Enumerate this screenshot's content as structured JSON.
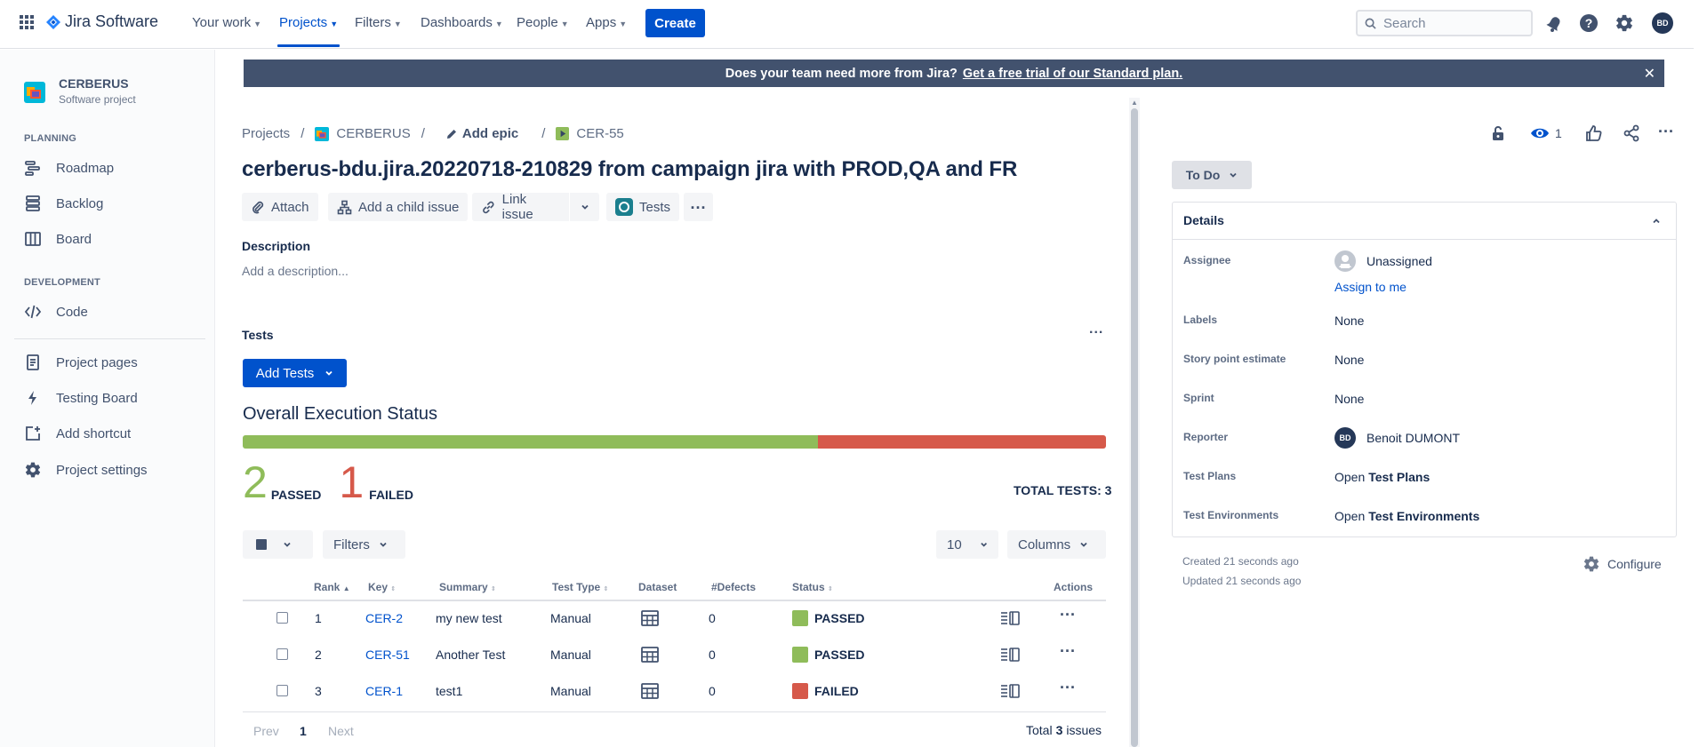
{
  "topnav": {
    "app_name": "Jira Software",
    "items": [
      {
        "label": "Your work"
      },
      {
        "label": "Projects"
      },
      {
        "label": "Filters"
      },
      {
        "label": "Dashboards"
      },
      {
        "label": "People"
      },
      {
        "label": "Apps"
      }
    ],
    "create_label": "Create",
    "search_placeholder": "Search",
    "avatar_initials": "BD"
  },
  "sidebar": {
    "project_name": "CERBERUS",
    "project_type": "Software project",
    "planning_label": "PLANNING",
    "planning_items": [
      {
        "label": "Roadmap",
        "icon": "roadmap-icon"
      },
      {
        "label": "Backlog",
        "icon": "backlog-icon"
      },
      {
        "label": "Board",
        "icon": "board-icon"
      }
    ],
    "development_label": "DEVELOPMENT",
    "development_items": [
      {
        "label": "Code",
        "icon": "code-icon"
      }
    ],
    "other_items": [
      {
        "label": "Project pages",
        "icon": "page-icon"
      },
      {
        "label": "Testing Board",
        "icon": "lightning-icon"
      },
      {
        "label": "Add shortcut",
        "icon": "add-shortcut-icon"
      },
      {
        "label": "Project settings",
        "icon": "gear-icon"
      }
    ]
  },
  "banner": {
    "text": "Does your team need more from Jira?",
    "link": "Get a free trial of our Standard plan."
  },
  "issue": {
    "breadcrumb": {
      "projects": "Projects",
      "project": "CERBERUS",
      "add_epic": "Add epic",
      "key": "CER-55"
    },
    "title": "cerberus-bdu.jira.20220718-210829 from campaign jira with PROD,QA and FR",
    "toolbar": {
      "attach": "Attach",
      "add_child": "Add a child issue",
      "link_issue": "Link issue",
      "tests": "Tests"
    },
    "description_label": "Description",
    "description_placeholder": "Add a description...",
    "tests_label": "Tests",
    "add_tests_label": "Add Tests"
  },
  "execution": {
    "title": "Overall Execution Status",
    "passed_count": "2",
    "passed_label": "PASSED",
    "failed_count": "1",
    "failed_label": "FAILED",
    "passed_fraction": 0.6667,
    "total_label": "TOTAL TESTS: 3",
    "colors": {
      "passed": "#8FBC5A",
      "failed": "#D6594A"
    }
  },
  "table_controls": {
    "filters_label": "Filters",
    "page_size": "10",
    "columns_label": "Columns"
  },
  "table": {
    "headers": {
      "rank": "Rank",
      "key": "Key",
      "summary": "Summary",
      "test_type": "Test Type",
      "dataset": "Dataset",
      "defects": "#Defects",
      "status": "Status",
      "actions": "Actions"
    },
    "rows": [
      {
        "rank": "1",
        "key": "CER-2",
        "summary": "my new test",
        "type": "Manual",
        "defects": "0",
        "status": "PASSED",
        "color": "#8FBC5A"
      },
      {
        "rank": "2",
        "key": "CER-51",
        "summary": "Another Test",
        "type": "Manual",
        "defects": "0",
        "status": "PASSED",
        "color": "#8FBC5A"
      },
      {
        "rank": "3",
        "key": "CER-1",
        "summary": "test1",
        "type": "Manual",
        "defects": "0",
        "status": "FAILED",
        "color": "#D6594A"
      }
    ],
    "pagination": {
      "prev": "Prev",
      "page": "1",
      "next": "Next",
      "total_prefix": "Total",
      "total_count": "3",
      "total_suffix": "issues"
    }
  },
  "right_panel": {
    "watchers_count": "1",
    "status_button": "To Do",
    "details_title": "Details",
    "fields": {
      "assignee_label": "Assignee",
      "assignee_value": "Unassigned",
      "assign_to_me": "Assign to me",
      "labels_label": "Labels",
      "labels_value": "None",
      "story_points_label": "Story point estimate",
      "story_points_value": "None",
      "sprint_label": "Sprint",
      "sprint_value": "None",
      "reporter_label": "Reporter",
      "reporter_initials": "BD",
      "reporter_value": "Benoit DUMONT",
      "test_plans_label": "Test Plans",
      "test_plans_open": "Open",
      "test_plans_value": "Test Plans",
      "test_env_label": "Test Environments",
      "test_env_open": "Open",
      "test_env_value": "Test Environments"
    },
    "created": "Created 21 seconds ago",
    "updated": "Updated 21 seconds ago",
    "configure": "Configure"
  }
}
